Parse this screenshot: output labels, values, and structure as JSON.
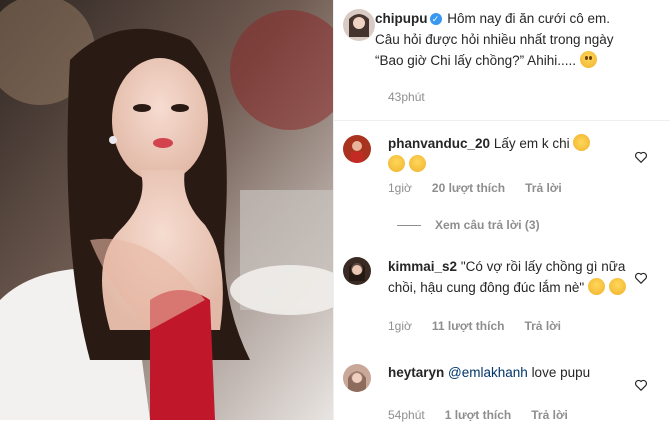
{
  "post": {
    "author": "chipupu",
    "caption": "Hôm nay đi ăn cưới cô em. Câu hỏi được hỏi nhiều nhất trong ngày “Bao giờ Chi lấy chồng?” Ahihi.....",
    "time": "43phút"
  },
  "comments": [
    {
      "username": "phanvanduc_20",
      "text": "Lấy em k chi",
      "time": "1giờ",
      "likes": "20 lượt thích",
      "reply": "Trả lời",
      "view_replies": "Xem câu trả lời (3)"
    },
    {
      "username": "kimmai_s2",
      "text": "\"Có vợ rồi lấy chồng gì nữa chồi, hậu cung đông đúc lắm nè\"",
      "time": "1giờ",
      "likes": "11 lượt thích",
      "reply": "Trả lời"
    },
    {
      "username": "heytaryn",
      "mention": "@emlakhanh",
      "text": "love pupu",
      "time": "54phút",
      "likes": "1 lượt thích",
      "reply": "Trả lời"
    }
  ],
  "icons": {
    "verified": "verified-badge-icon",
    "like": "heart-outline-icon"
  },
  "colors": {
    "verified": "#3897f0",
    "meta": "#8e8e8e",
    "text": "#262626"
  }
}
